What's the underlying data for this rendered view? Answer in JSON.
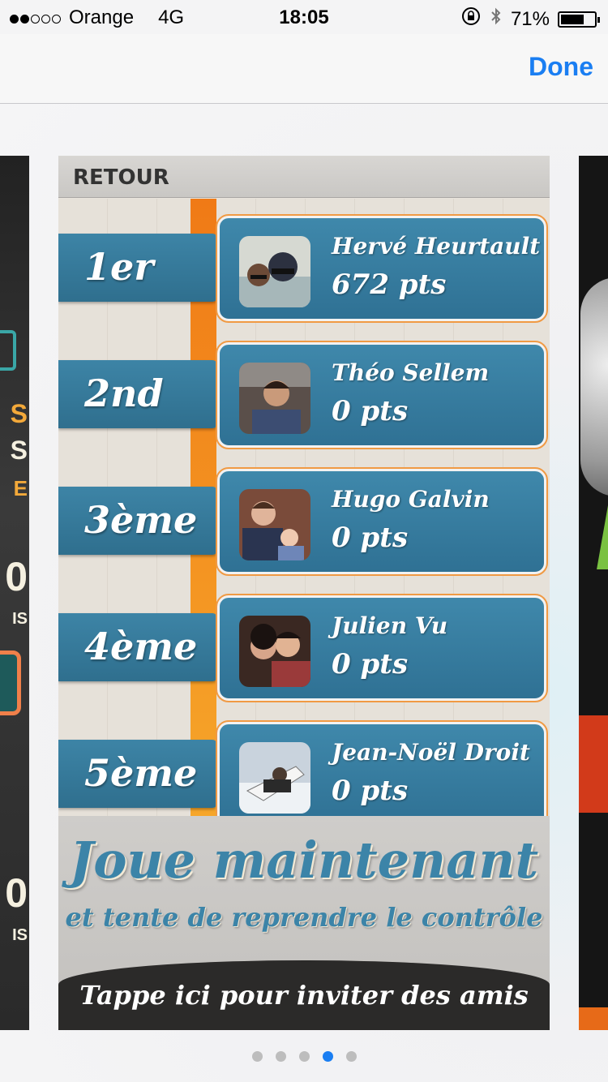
{
  "status": {
    "carrier": "Orange",
    "network": "4G",
    "time": "18:05",
    "battery": "71%",
    "battery_level": 0.71,
    "signal_bars": 2
  },
  "nav": {
    "done_label": "Done"
  },
  "game": {
    "back_label": "RETOUR",
    "leaderboard": [
      {
        "rank": "1er",
        "name": "Hervé Heurtault",
        "score": "672 pts"
      },
      {
        "rank": "2nd",
        "name": "Théo Sellem",
        "score": "0 pts"
      },
      {
        "rank": "3ème",
        "name": "Hugo Galvin",
        "score": "0 pts"
      },
      {
        "rank": "4ème",
        "name": "Julien Vu",
        "score": "0 pts"
      },
      {
        "rank": "5ème",
        "name": "Jean-Noël Droit",
        "score": "0 pts"
      }
    ],
    "promo_title": "Joue maintenant",
    "promo_subtitle": "et tente de reprendre le contrôle",
    "invite_label": "Tappe ici pour inviter des amis"
  },
  "pager": {
    "count": 5,
    "current": 4
  },
  "colors": {
    "accent": "#1a7ef2",
    "card_blue": "#3f88ab",
    "rail_orange": "#f07a16"
  }
}
